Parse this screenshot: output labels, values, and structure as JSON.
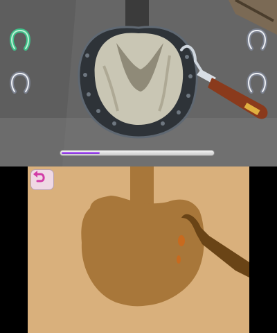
{
  "game": {
    "task": "hoof-cleaning",
    "progress": 0.25,
    "colors": {
      "progress_fill": "#8a3fe0",
      "bottom_bg": "#d9b07c",
      "hoof_silhouette": "#a8773a",
      "leg_silhouette": "#a8773a",
      "pick_silhouette": "#6a4416",
      "dirt_spot": "#c86a1e",
      "active_shoe": "#3fc28a",
      "inactive_shoe": "#d0d4dc",
      "back_button_bg": "#efd8e4",
      "back_arrow": "#d23aa6"
    }
  },
  "horseshoes": [
    {
      "id": "top-left",
      "state": "active",
      "icon": "horseshoe-icon"
    },
    {
      "id": "top-right",
      "state": "inactive",
      "icon": "horseshoe-icon"
    },
    {
      "id": "bottom-left",
      "state": "inactive",
      "icon": "horseshoe-icon"
    },
    {
      "id": "bottom-right",
      "state": "inactive",
      "icon": "horseshoe-icon"
    }
  ],
  "controls": {
    "back_icon": "undo-arrow-icon",
    "tool_icon": "hoof-pick-icon"
  }
}
